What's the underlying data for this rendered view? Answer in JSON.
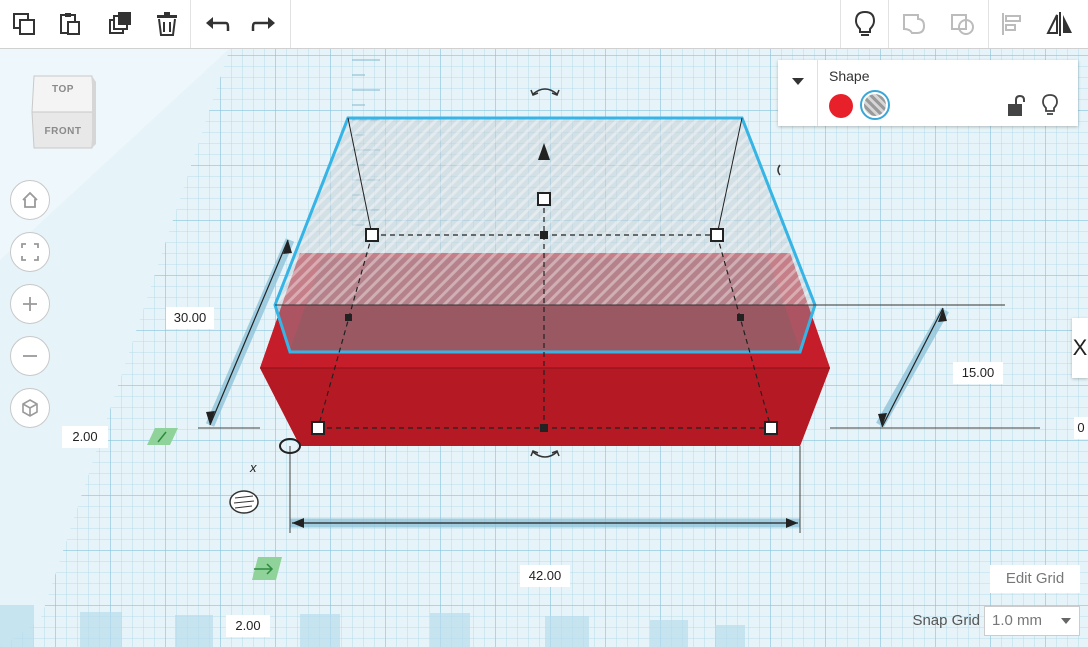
{
  "toolbar": {
    "buttons": [
      {
        "name": "copy-icon"
      },
      {
        "name": "paste-icon"
      },
      {
        "name": "duplicate-icon"
      },
      {
        "name": "delete-icon"
      },
      {
        "name": "undo-icon"
      },
      {
        "name": "redo-icon"
      },
      {
        "name": "show-all-icon"
      },
      {
        "name": "group-icon"
      },
      {
        "name": "ungroup-icon"
      },
      {
        "name": "align-icon"
      },
      {
        "name": "mirror-icon"
      }
    ]
  },
  "view_cube": {
    "top_label": "TOP",
    "front_label": "FRONT"
  },
  "nav_buttons": [
    "home-icon",
    "fit-view-icon",
    "zoom-in-icon",
    "zoom-out-icon",
    "perspective-icon"
  ],
  "inspector": {
    "title": "Shape",
    "solid_color": "#e8202a",
    "hole_pattern": "striped-gray"
  },
  "dimensions": {
    "depth": "30.00",
    "elevation_left": "2.00",
    "height": "15.00",
    "right_partial": "0",
    "width": "42.00",
    "offset_bottom": "2.00"
  },
  "grid_controls": {
    "edit_grid_label": "Edit Grid",
    "snap_grid_label": "Snap Grid",
    "snap_value": "1.0 mm"
  },
  "side_tab_glyph": "X",
  "colors": {
    "workplane": "#d9eef5",
    "grid_line": "#9fd0e4",
    "box_red": "#c01b25",
    "selection": "#35b4e6",
    "hole_glass": "#a7b8c3"
  }
}
